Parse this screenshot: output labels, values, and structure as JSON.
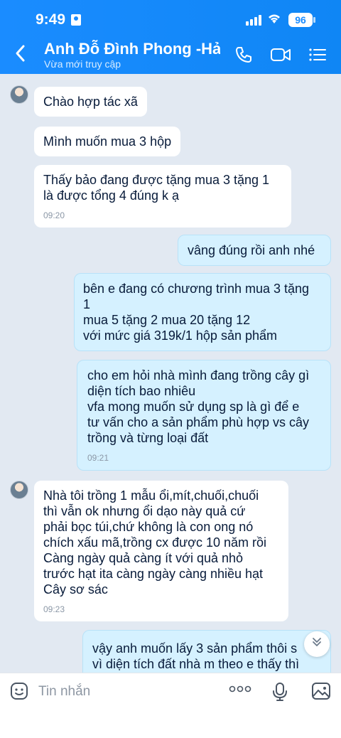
{
  "status_bar": {
    "time": "9:49",
    "battery": "96"
  },
  "header": {
    "contact_name": "Anh Đỗ Đình Phong -Hải...",
    "status": "Vừa mới truy cập"
  },
  "messages": [
    {
      "side": "in",
      "text": "Chào hợp tác xã"
    },
    {
      "side": "in",
      "text": "Mình muốn mua 3 hộp"
    },
    {
      "side": "in",
      "lines": [
        "Thấy bảo đang được tặng mua 3 tặng 1",
        "là được tổng 4 đúng k ạ"
      ],
      "time": "09:20"
    },
    {
      "side": "out",
      "text": "vâng đúng rồi anh nhé"
    },
    {
      "side": "out",
      "lines": [
        "bên e đang có chương trình mua 3 tặng",
        "1",
        "mua 5 tặng 2 mua 20 tặng 12",
        "với mức giá 319k/1 hộp sản phẩm"
      ]
    },
    {
      "side": "out",
      "lines": [
        "cho em hỏi nhà mình đang trồng cây gì",
        "diện tích bao nhiêu",
        "vfa mong muốn sử dụng sp là gì để e",
        "tư vấn cho a sản phẩm phù hợp vs cây",
        "trồng và từng loại đất"
      ],
      "time": "09:21"
    },
    {
      "side": "in",
      "lines": [
        "Nhà tôi trồng 1 mẫu ổi,mít,chuối,chuối",
        "thì vẫn ok nhưng ổi dạo này quả cứ",
        "phải bọc túi,chứ không là con ong nó",
        "chích xấu mã,trồng cx được 10 năm rồi",
        "Càng ngày quả càng ít với quả nhỏ",
        "trước hạt ita càng ngày càng nhiều hạt",
        "Cây sơ sác"
      ],
      "time": "09:23"
    },
    {
      "side": "out",
      "lines": [
        "vậy anh muốn lấy 3 sản phẩm thôi s",
        "vì diện tích đất nhà m theo e thấy thì"
      ]
    }
  ],
  "input": {
    "placeholder": "Tin nhắn"
  },
  "colors": {
    "header": "#1a8cff",
    "chat_background": "#e2e9f2",
    "incoming_bubble": "#ffffff",
    "outgoing_bubble": "#d5f1ff"
  },
  "icons": [
    "back-arrow-icon",
    "phone-icon",
    "video-call-icon",
    "menu-list-icon",
    "emoji-icon",
    "more-options-icon",
    "microphone-icon",
    "image-icon",
    "scroll-down-icon"
  ]
}
